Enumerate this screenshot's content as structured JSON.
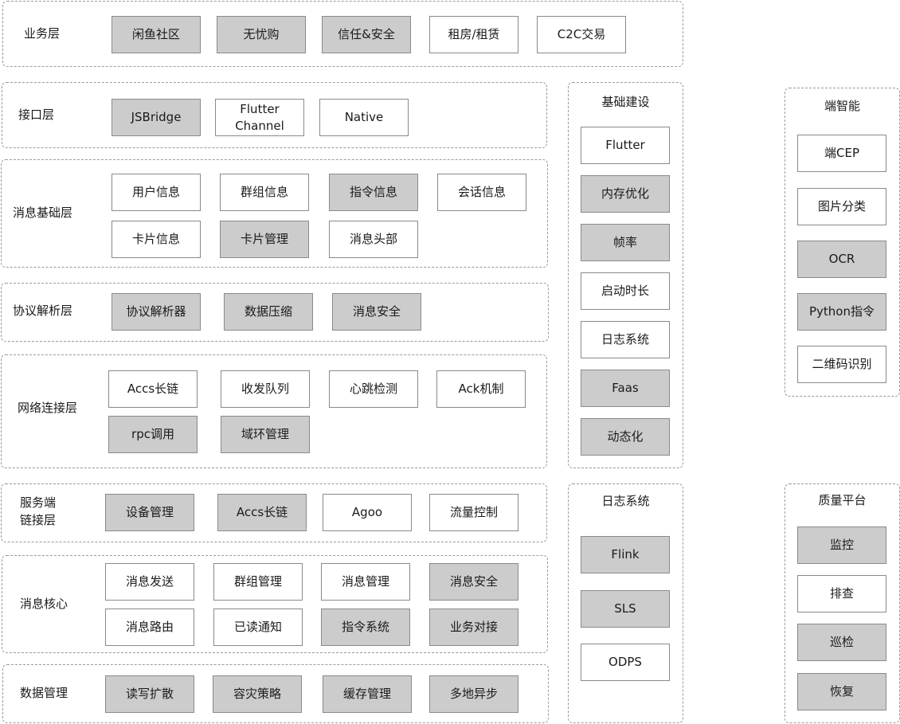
{
  "colors": {
    "highlight_fill": "#cccccc",
    "plain_fill": "#ffffff",
    "border": "#8a8a8a",
    "dash": "#9a9a9a"
  },
  "layers": {
    "business": {
      "label": "业务层",
      "items": [
        {
          "text": "闲鱼社区",
          "highlight": true
        },
        {
          "text": "无忧购",
          "highlight": true
        },
        {
          "text": "信任&安全",
          "highlight": true
        },
        {
          "text": "租房/租赁",
          "highlight": false
        },
        {
          "text": "C2C交易",
          "highlight": false
        }
      ]
    },
    "interface": {
      "label": "接口层",
      "items": [
        {
          "text": "JSBridge",
          "highlight": true
        },
        {
          "text": "Flutter Channel",
          "highlight": false
        },
        {
          "text": "Native",
          "highlight": false
        }
      ]
    },
    "msg_base": {
      "label": "消息基础层",
      "items": [
        {
          "text": "用户信息",
          "highlight": false
        },
        {
          "text": "群组信息",
          "highlight": false
        },
        {
          "text": "指令信息",
          "highlight": true
        },
        {
          "text": "会话信息",
          "highlight": false
        },
        {
          "text": "卡片信息",
          "highlight": false
        },
        {
          "text": "卡片管理",
          "highlight": true
        },
        {
          "text": "消息头部",
          "highlight": false
        }
      ]
    },
    "protocol": {
      "label": "协议解析层",
      "items": [
        {
          "text": "协议解析器",
          "highlight": true
        },
        {
          "text": "数据压缩",
          "highlight": true
        },
        {
          "text": "消息安全",
          "highlight": true
        }
      ]
    },
    "network": {
      "label": "网络连接层",
      "items": [
        {
          "text": "Accs长链",
          "highlight": false
        },
        {
          "text": "收发队列",
          "highlight": false
        },
        {
          "text": "心跳检测",
          "highlight": false
        },
        {
          "text": "Ack机制",
          "highlight": false
        },
        {
          "text": "rpc调用",
          "highlight": true
        },
        {
          "text": "域环管理",
          "highlight": true
        }
      ]
    },
    "server_link": {
      "label_line1": "服务端",
      "label_line2": "链接层",
      "items": [
        {
          "text": "设备管理",
          "highlight": true
        },
        {
          "text": "Accs长链",
          "highlight": true
        },
        {
          "text": "Agoo",
          "highlight": false
        },
        {
          "text": "流量控制",
          "highlight": false
        }
      ]
    },
    "msg_core": {
      "label": "消息核心",
      "items": [
        {
          "text": "消息发送",
          "highlight": false
        },
        {
          "text": "群组管理",
          "highlight": false
        },
        {
          "text": "消息管理",
          "highlight": false
        },
        {
          "text": "消息安全",
          "highlight": true
        },
        {
          "text": "消息路由",
          "highlight": false
        },
        {
          "text": "已读通知",
          "highlight": false
        },
        {
          "text": "指令系统",
          "highlight": true
        },
        {
          "text": "业务对接",
          "highlight": true
        }
      ]
    },
    "data_mgmt": {
      "label": "数据管理",
      "items": [
        {
          "text": "读写扩散",
          "highlight": true
        },
        {
          "text": "容灾策略",
          "highlight": true
        },
        {
          "text": "缓存管理",
          "highlight": true
        },
        {
          "text": "多地异步",
          "highlight": true
        }
      ]
    }
  },
  "side": {
    "infra": {
      "title": "基础建设",
      "items": [
        {
          "text": "Flutter",
          "highlight": false
        },
        {
          "text": "内存优化",
          "highlight": true
        },
        {
          "text": "帧率",
          "highlight": true
        },
        {
          "text": "启动时长",
          "highlight": false
        },
        {
          "text": "日志系统",
          "highlight": false
        },
        {
          "text": "Faas",
          "highlight": true
        },
        {
          "text": "动态化",
          "highlight": true
        }
      ]
    },
    "log": {
      "title": "日志系统",
      "items": [
        {
          "text": "Flink",
          "highlight": true
        },
        {
          "text": "SLS",
          "highlight": true
        },
        {
          "text": "ODPS",
          "highlight": false
        }
      ]
    },
    "edge_ai": {
      "title": "端智能",
      "items": [
        {
          "text": "端CEP",
          "highlight": false
        },
        {
          "text": "图片分类",
          "highlight": false
        },
        {
          "text": "OCR",
          "highlight": true
        },
        {
          "text": "Python指令",
          "highlight": true
        },
        {
          "text": "二维码识别",
          "highlight": false
        }
      ]
    },
    "quality": {
      "title": "质量平台",
      "items": [
        {
          "text": "监控",
          "highlight": true
        },
        {
          "text": "排查",
          "highlight": false
        },
        {
          "text": "巡检",
          "highlight": true
        },
        {
          "text": "恢复",
          "highlight": true
        }
      ]
    }
  }
}
